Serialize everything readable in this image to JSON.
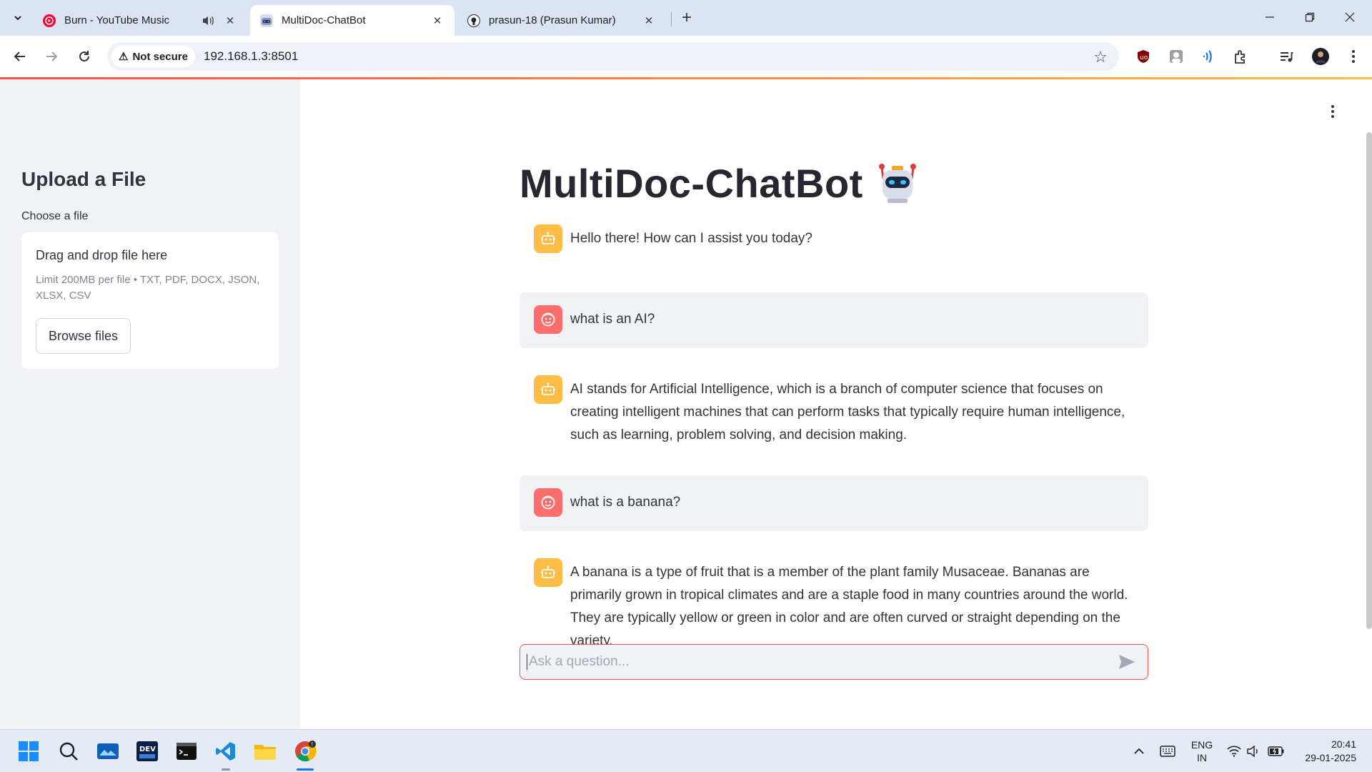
{
  "browser": {
    "tabs": [
      {
        "title": "Burn - YouTube Music",
        "favicon": "youtube-music-icon",
        "audio": true,
        "active": false
      },
      {
        "title": "MultiDoc-ChatBot",
        "favicon": "robot-icon",
        "audio": false,
        "active": true
      },
      {
        "title": "prasun-18 (Prasun Kumar)",
        "favicon": "github-icon",
        "audio": false,
        "active": false
      }
    ],
    "security_label": "Not secure",
    "url": "192.168.1.3:8501"
  },
  "sidebar": {
    "title": "Upload a File",
    "uploader_label": "Choose a file",
    "dropzone_title": "Drag and drop file here",
    "dropzone_hint": "Limit 200MB per file • TXT, PDF, DOCX, JSON, XLSX, CSV",
    "browse_label": "Browse files"
  },
  "main": {
    "title": "MultiDoc-ChatBot",
    "messages": [
      {
        "role": "assistant",
        "text": "Hello there! How can I assist you today?"
      },
      {
        "role": "user",
        "text": "what is an AI?"
      },
      {
        "role": "assistant",
        "text": "AI stands for Artificial Intelligence, which is a branch of computer science that focuses on creating intelligent machines that can perform tasks that typically require human intelligence, such as learning, problem solving, and decision making."
      },
      {
        "role": "user",
        "text": "what is a banana?"
      },
      {
        "role": "assistant",
        "text": "A banana is a type of fruit that is a member of the plant family Musaceae. Bananas are primarily grown in tropical climates and are a staple food in many countries around the world. They are typically yellow or green in color and are often curved or straight depending on the variety."
      }
    ],
    "input_placeholder": "Ask a question..."
  },
  "taskbar": {
    "language": "ENG",
    "region": "IN",
    "time": "20:41",
    "date": "29-01-2025"
  },
  "colors": {
    "accent": "#ff4b4b",
    "bot_avatar": "#ffbd45",
    "user_avatar": "#ff6c6c",
    "sidebar_bg": "#f0f2f6"
  }
}
